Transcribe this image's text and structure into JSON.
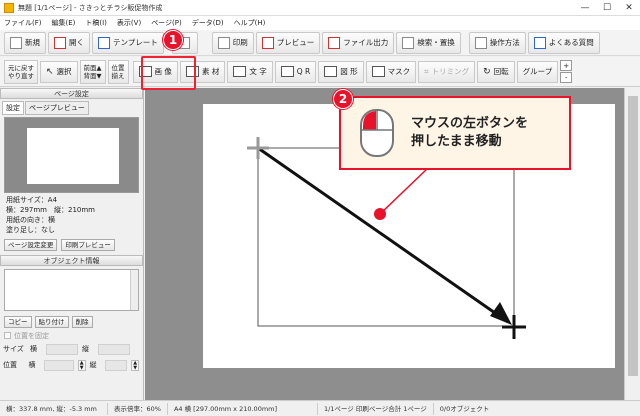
{
  "window": {
    "title": "無題 [1/1ページ] - さきっとチラシ販促物作成",
    "controls": [
      "—",
      "☐",
      "✕"
    ]
  },
  "menu": [
    "ファイル(F)",
    "編集(E)",
    "ト稿(I)",
    "表示(V)",
    "ページ(P)",
    "データ(D)",
    "ヘルプ(H)"
  ],
  "toolbar1": {
    "new": "新規",
    "open": "開く",
    "template": "テンプレート",
    "print": "印刷",
    "preview": "プレビュー",
    "file_output": "ファイル出力",
    "search_replace": "検索・置換",
    "how_to": "操作方法",
    "faq": "よくある質問"
  },
  "toolbar2": {
    "undo_line1": "元に戻す",
    "undo_line2": "やり直す",
    "select": "選択",
    "front_line1": "前面▲",
    "front_line2": "背面▼",
    "align_line1": "位置",
    "align_line2": "揃え",
    "image": "画 像",
    "material": "素 材",
    "text": "文 字",
    "qr": "Q R",
    "shape": "図 形",
    "mask": "マスク",
    "trimming": "トリミング",
    "rotate": "回転",
    "group": "グループ",
    "zoom_in": "+",
    "zoom_out": "-"
  },
  "annotations": {
    "step1": "1",
    "step2": "2",
    "callout_line1": "マウスの左ボタンを",
    "callout_line2": "押したまま移動"
  },
  "page_settings": {
    "header": "ページ設定",
    "tab_settings": "設定",
    "tab_preview": "ページプレビュー",
    "paper_size": "用紙サイズ：A4",
    "dimensions": "横：297mm　縦：210mm",
    "orientation": "用紙の向き：横",
    "bleed": "塗り足し：なし",
    "change_button": "ページ設定変更",
    "print_preview_button": "印刷プレビュー"
  },
  "object_info": {
    "header": "オブジェクト情報",
    "copy": "コピー",
    "paste": "貼り付け",
    "delete": "削除",
    "fix_position": "位置を固定",
    "size_label": "サイズ",
    "position_label": "位置",
    "width_label": "横",
    "height_label": "縦"
  },
  "status": {
    "coords": "横：337.8 mm, 縦：-5.3 mm",
    "zoom": "表示倍率：60%",
    "paper": "A4 横 [297.00mm x 210.00mm]",
    "pages": "1/1ページ 印刷ページ合計 1ページ",
    "objects": "0/0オブジェクト"
  },
  "colors": {
    "accent_red": "#e8132a",
    "callout_bg": "#fff5e6",
    "canvas_gray": "#8e8e8e"
  }
}
